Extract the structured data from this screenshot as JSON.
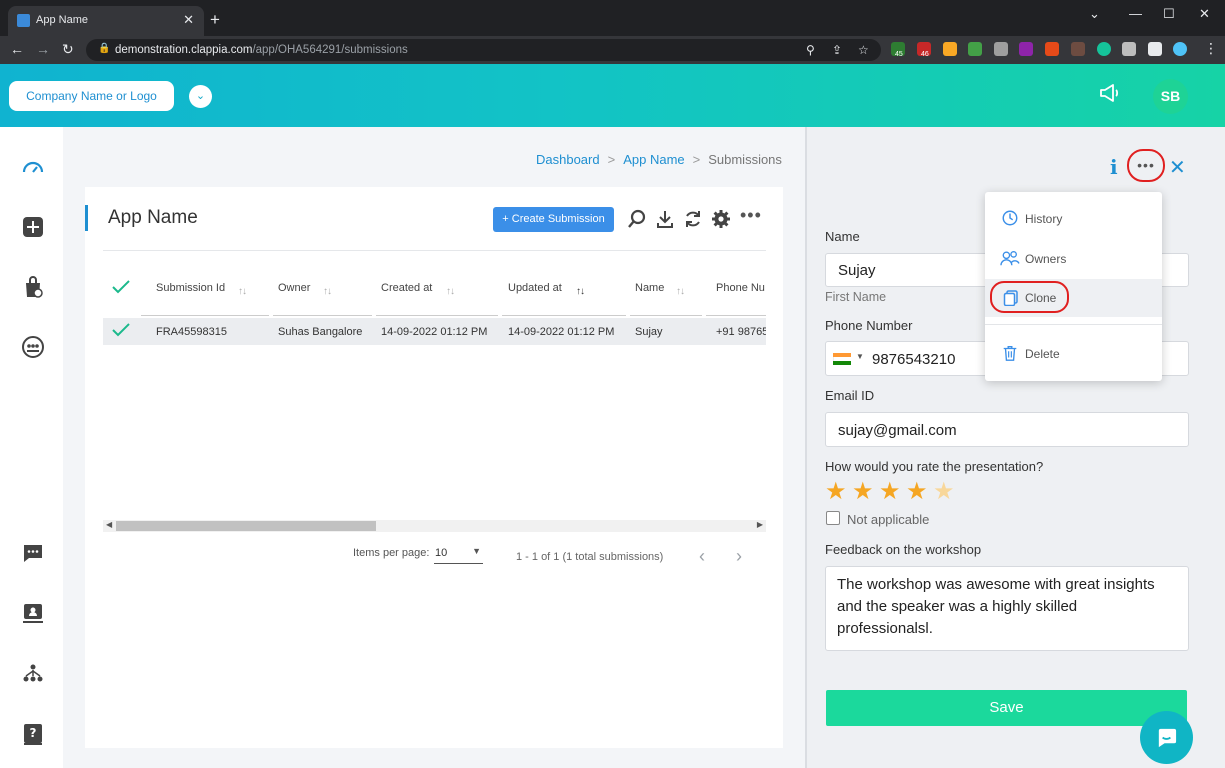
{
  "browser": {
    "tab_title": "App Name",
    "tab_close": "✕",
    "new_tab": "+",
    "url_host": "demonstration.clappia.com",
    "url_path": "/app/OHA564291/submissions",
    "badge_1": "45",
    "badge_2": "46"
  },
  "header": {
    "logo_label": "Company Name or Logo",
    "avatar_initials": "SB"
  },
  "breadcrumb": {
    "items": [
      "Dashboard",
      "App Name",
      "Submissions"
    ],
    "separator": ">"
  },
  "card": {
    "title": "App Name",
    "create_button": "+ Create Submission"
  },
  "table": {
    "columns": [
      "Submission Id",
      "Owner",
      "Created at",
      "Updated at",
      "Name",
      "Phone Nu"
    ],
    "rows": [
      {
        "submission_id": "FRA45598315",
        "owner": "Suhas Bangalore",
        "created_at": "14-09-2022 01:12 PM",
        "updated_at": "14-09-2022 01:12 PM",
        "name": "Sujay",
        "phone": "+91 98765"
      }
    ]
  },
  "pager": {
    "items_per_page_label": "Items per page:",
    "items_per_page_value": "10",
    "range_text": "1 - 1 of 1 (1 total submissions)"
  },
  "form": {
    "name_label": "Name",
    "name_value": "Sujay",
    "name_hint": "First Name",
    "phone_label": "Phone Number",
    "phone_value": "9876543210",
    "email_label": "Email ID",
    "email_value": "sujay@gmail.com",
    "rating_label": "How would you rate the presentation?",
    "rating_value": 4,
    "rating_max": 5,
    "not_applicable_label": "Not applicable",
    "feedback_label": "Feedback on the workshop",
    "feedback_value": "The workshop was awesome with great insights and the speaker was a highly skilled professionalsl.",
    "save_label": "Save"
  },
  "menu": {
    "history": "History",
    "owners": "Owners",
    "clone": "Clone",
    "delete": "Delete"
  },
  "colors": {
    "accent": "#1e8fd1",
    "save": "#1bd99c",
    "star_on": "#f5a623",
    "star_off": "#f8d79a",
    "highlight_ring": "#e02020"
  }
}
